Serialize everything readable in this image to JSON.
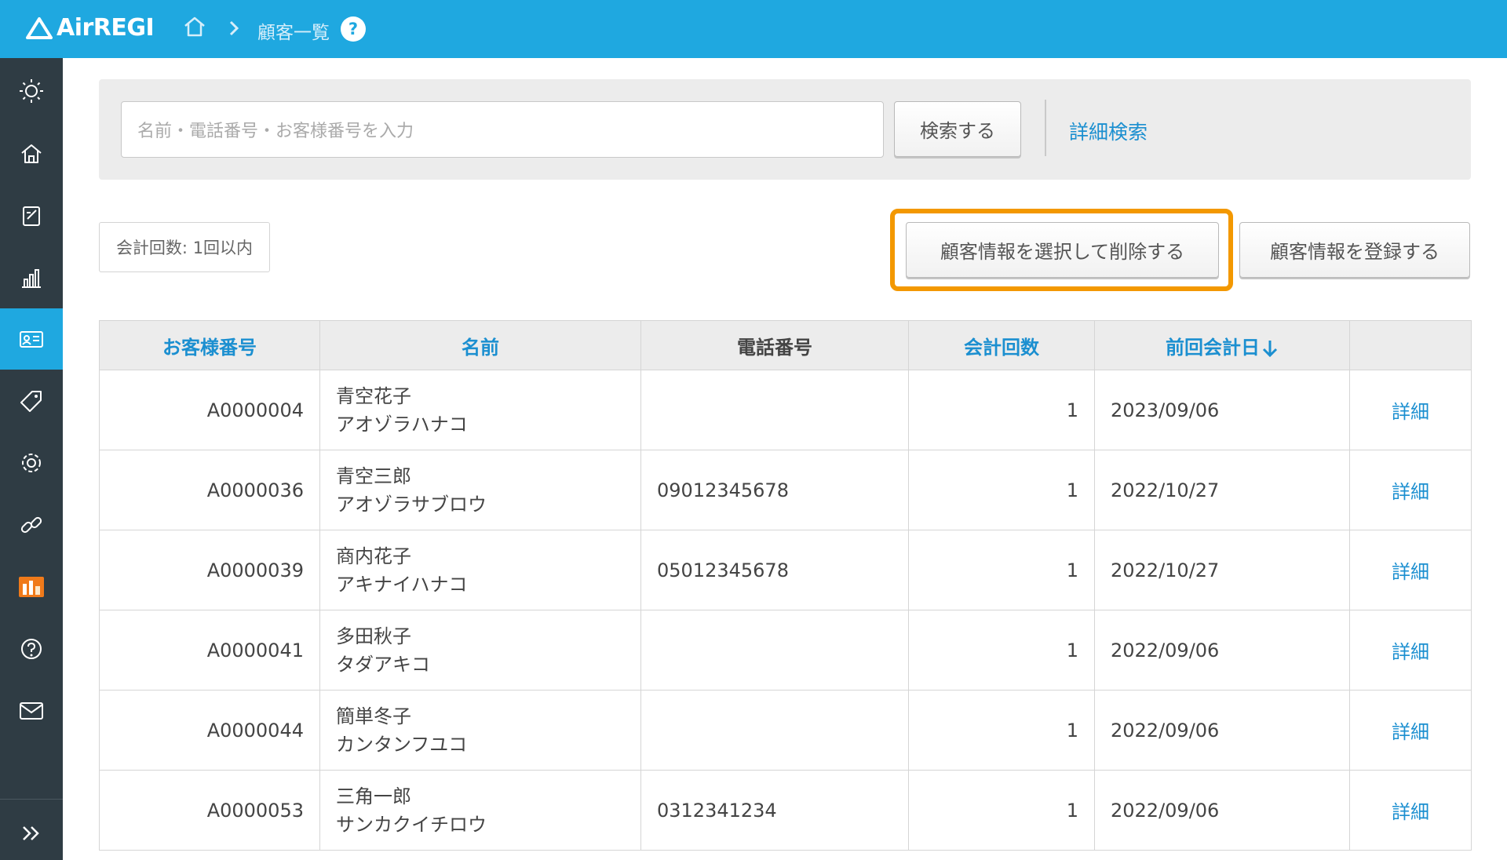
{
  "header": {
    "logo_text": "AirREGI",
    "breadcrumb_title": "顧客一覧",
    "help_label": "?"
  },
  "sidebar": {
    "items": [
      {
        "icon": "sun-icon"
      },
      {
        "icon": "home-icon"
      },
      {
        "icon": "edit-icon"
      },
      {
        "icon": "chart-icon"
      },
      {
        "icon": "customer-card-icon",
        "active": true
      },
      {
        "icon": "tag-icon"
      },
      {
        "icon": "gear-icon"
      },
      {
        "icon": "link-icon"
      },
      {
        "icon": "store-icon"
      },
      {
        "icon": "help-icon"
      },
      {
        "icon": "mail-icon"
      }
    ],
    "collapse_label": ">>"
  },
  "search": {
    "placeholder": "名前・電話番号・お客様番号を入力",
    "button_label": "検索する",
    "detail_link": "詳細検索"
  },
  "filter": {
    "label": "会計回数: 1回以内"
  },
  "actions": {
    "delete_label": "顧客情報を選択して削除する",
    "register_label": "顧客情報を登録する"
  },
  "colors": {
    "header_bg": "#1fa8e0",
    "sidebar_bg": "#2f3c44",
    "link": "#1b8fd0",
    "highlight": "#f39800"
  },
  "table": {
    "headers": {
      "customer_no": "お客様番号",
      "name": "名前",
      "phone": "電話番号",
      "visits": "会計回数",
      "last_date": "前回会計日"
    },
    "detail_label": "詳細",
    "rows": [
      {
        "id": "A0000004",
        "name": "青空花子",
        "kana": "アオゾラハナコ",
        "phone": "",
        "visits": "1",
        "date": "2023/09/06"
      },
      {
        "id": "A0000036",
        "name": "青空三郎",
        "kana": "アオゾラサブロウ",
        "phone": "09012345678",
        "visits": "1",
        "date": "2022/10/27"
      },
      {
        "id": "A0000039",
        "name": "商内花子",
        "kana": "アキナイハナコ",
        "phone": "05012345678",
        "visits": "1",
        "date": "2022/10/27"
      },
      {
        "id": "A0000041",
        "name": "多田秋子",
        "kana": "タダアキコ",
        "phone": "",
        "visits": "1",
        "date": "2022/09/06"
      },
      {
        "id": "A0000044",
        "name": "簡単冬子",
        "kana": "カンタンフユコ",
        "phone": "",
        "visits": "1",
        "date": "2022/09/06"
      },
      {
        "id": "A0000053",
        "name": "三角一郎",
        "kana": "サンカクイチロウ",
        "phone": "0312341234",
        "visits": "1",
        "date": "2022/09/06"
      }
    ]
  }
}
